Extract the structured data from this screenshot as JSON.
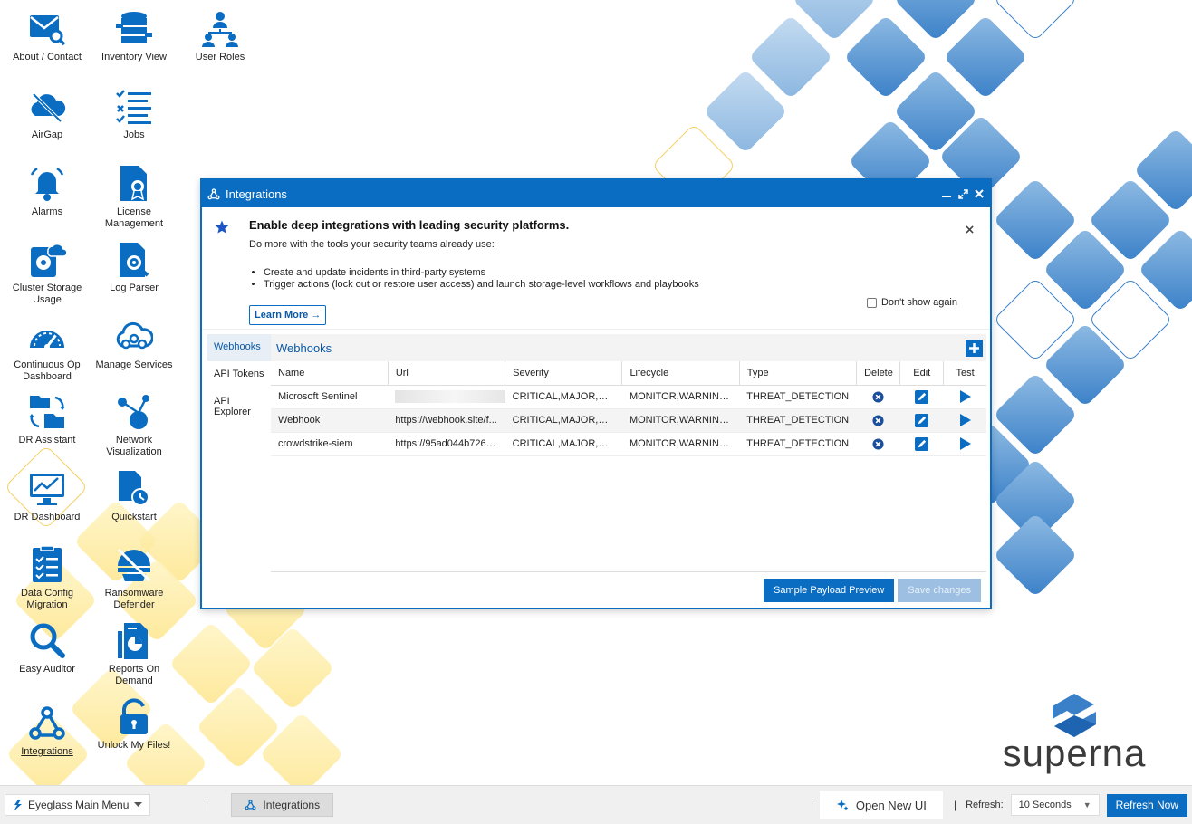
{
  "desktop": {
    "icons": [
      {
        "label": "About / Contact"
      },
      {
        "label": "Inventory View"
      },
      {
        "label": "User Roles"
      },
      {
        "label": "AirGap"
      },
      {
        "label": "Jobs"
      },
      {
        "label": "Alarms"
      },
      {
        "label": "License Management"
      },
      {
        "label": "Cluster Storage Usage"
      },
      {
        "label": "Log Parser"
      },
      {
        "label": "Continuous Op Dashboard"
      },
      {
        "label": "Manage Services"
      },
      {
        "label": "DR Assistant"
      },
      {
        "label": "Network Visualization"
      },
      {
        "label": "DR Dashboard"
      },
      {
        "label": "Quickstart"
      },
      {
        "label": "Data Config Migration"
      },
      {
        "label": "Ransomware Defender"
      },
      {
        "label": "Easy Auditor"
      },
      {
        "label": "Reports On Demand"
      },
      {
        "label": "Integrations"
      },
      {
        "label": "Unlock My Files!"
      }
    ]
  },
  "window": {
    "title": "Integrations",
    "banner": {
      "heading": "Enable deep integrations with leading security platforms.",
      "subtitle": "Do more with the tools your security teams already use:",
      "bullets": [
        "Create and update incidents in third-party systems",
        "Trigger actions (lock out or restore user access) and launch storage-level workflows and playbooks"
      ],
      "learn_more": "Learn More →",
      "dont_show_again": "Don't show again"
    },
    "sidebar": {
      "items": [
        {
          "label": "Webhooks"
        },
        {
          "label": "API Tokens"
        },
        {
          "label": "API Explorer"
        }
      ]
    },
    "section_title": "Webhooks",
    "table": {
      "columns": [
        "Name",
        "Url",
        "Severity",
        "Lifecycle",
        "Type",
        "Delete",
        "Edit",
        "Test"
      ],
      "rows": [
        {
          "name": "Microsoft Sentinel",
          "url": "",
          "severity": "CRITICAL,MAJOR,WAR...",
          "lifecycle": "MONITOR,WARNING,D...",
          "type": "THREAT_DETECTION"
        },
        {
          "name": "Webhook",
          "url": "https://webhook.site/f...",
          "severity": "CRITICAL,MAJOR,WAR...",
          "lifecycle": "MONITOR,WARNING,D...",
          "type": "THREAT_DETECTION"
        },
        {
          "name": "crowdstrike-siem",
          "url": "https://95ad044b726d...",
          "severity": "CRITICAL,MAJOR,WAR...",
          "lifecycle": "MONITOR,WARNING,L...",
          "type": "THREAT_DETECTION"
        }
      ]
    },
    "footer": {
      "sample_payload": "Sample Payload Preview",
      "save_changes": "Save changes"
    }
  },
  "taskbar": {
    "main_menu": "Eyeglass Main Menu",
    "task": "Integrations",
    "open_new_ui": "Open New UI",
    "separator": "|",
    "refresh_label": "Refresh:",
    "refresh_value": "10 Seconds",
    "refresh_now": "Refresh Now"
  },
  "logo": {
    "text": "superna"
  },
  "colors": {
    "accent": "#0a6dc2",
    "disabled": "#9dbfe2",
    "brand_blue": "#3a80c8",
    "yellow": "#fde58a"
  },
  "icon_names": [
    "envelope-search-icon",
    "database-icon",
    "user-roles-icon",
    "cloud-off-icon",
    "checklist-icon",
    "bell-icon",
    "license-icon",
    "disk-cloud-icon",
    "log-search-icon",
    "gauge-icon",
    "cloud-network-icon",
    "folder-sync-icon",
    "network-nodes-icon",
    "monitor-chart-icon",
    "clock-doc-icon",
    "doc-checklist-icon",
    "ransomware-shield-icon",
    "magnifier-icon",
    "report-pie-icon",
    "webhook-icon",
    "unlock-icon"
  ]
}
